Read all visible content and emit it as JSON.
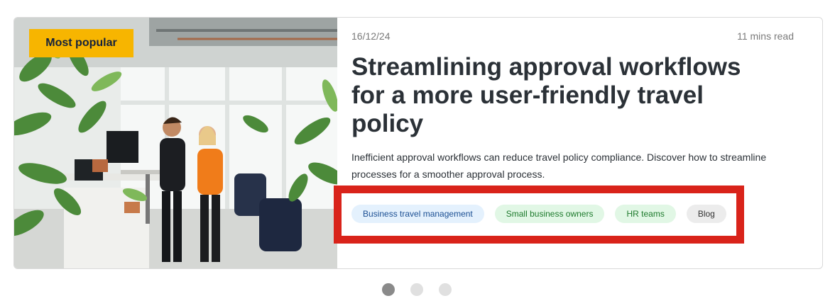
{
  "card": {
    "badge": "Most popular",
    "image_alt": "Two colleagues working at a standing desk in a bright office with plants",
    "date": "16/12/24",
    "read_time": "11 mins read",
    "title": "Streamlining approval workflows for a more user-friendly travel policy",
    "description": "Inefficient approval workflows can reduce travel policy compliance. Discover how to streamline processes for a smoother approval process.",
    "tags": [
      {
        "label": "Business travel management",
        "color": "#1b4f93",
        "bg": "#e4f1fd"
      },
      {
        "label": "Small business owners",
        "color": "#1d7a2c",
        "bg": "#e1f7e5"
      },
      {
        "label": "HR teams",
        "color": "#1d7a2c",
        "bg": "#e1f7e5"
      },
      {
        "label": "Blog",
        "color": "#333333",
        "bg": "#ececec"
      }
    ]
  },
  "carousel": {
    "total": 3,
    "active": 1
  },
  "colors": {
    "badge": "#f7b500",
    "highlight": "#d9231a",
    "title": "#2b3137"
  }
}
